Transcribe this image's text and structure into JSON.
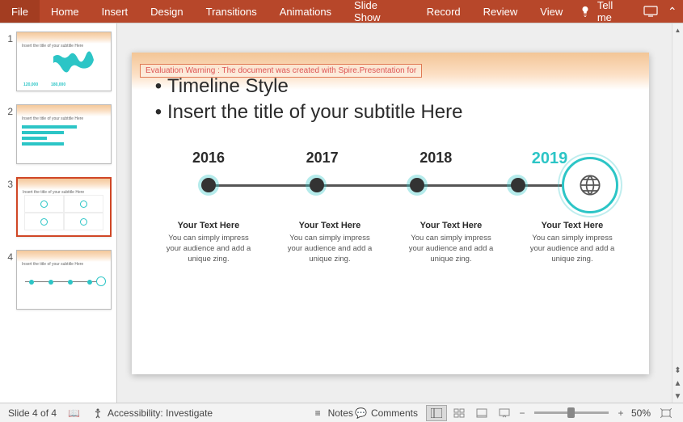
{
  "ribbon": {
    "tabs": [
      "File",
      "Home",
      "Insert",
      "Design",
      "Transitions",
      "Animations",
      "Slide Show",
      "Record",
      "Review",
      "View"
    ],
    "tellme": "Tell me"
  },
  "thumbs": [
    {
      "num": "1",
      "title": "",
      "sub": "Insert the title of your subtitle Here"
    },
    {
      "num": "2",
      "title": "",
      "sub": "Insert the title of your subtitle Here"
    },
    {
      "num": "3",
      "title": "",
      "sub": "Insert the title of your subtitle Here"
    },
    {
      "num": "4",
      "title": "",
      "sub": "Insert the title of your subtitle Here"
    }
  ],
  "slide": {
    "warning": "Evaluation Warning : The document was created with Spire.Presentation for",
    "title": "Timeline Style",
    "subtitle": "Insert the title of your subtitle Here",
    "years": [
      "2016",
      "2017",
      "2018",
      "2019"
    ],
    "texthead": "Your Text Here",
    "textbody": "You can simply impress your audience and add a unique zing."
  },
  "status": {
    "slide": "Slide 4 of 4",
    "access": "Accessibility: Investigate",
    "notes": "Notes",
    "comments": "Comments",
    "zoom": "50%"
  }
}
